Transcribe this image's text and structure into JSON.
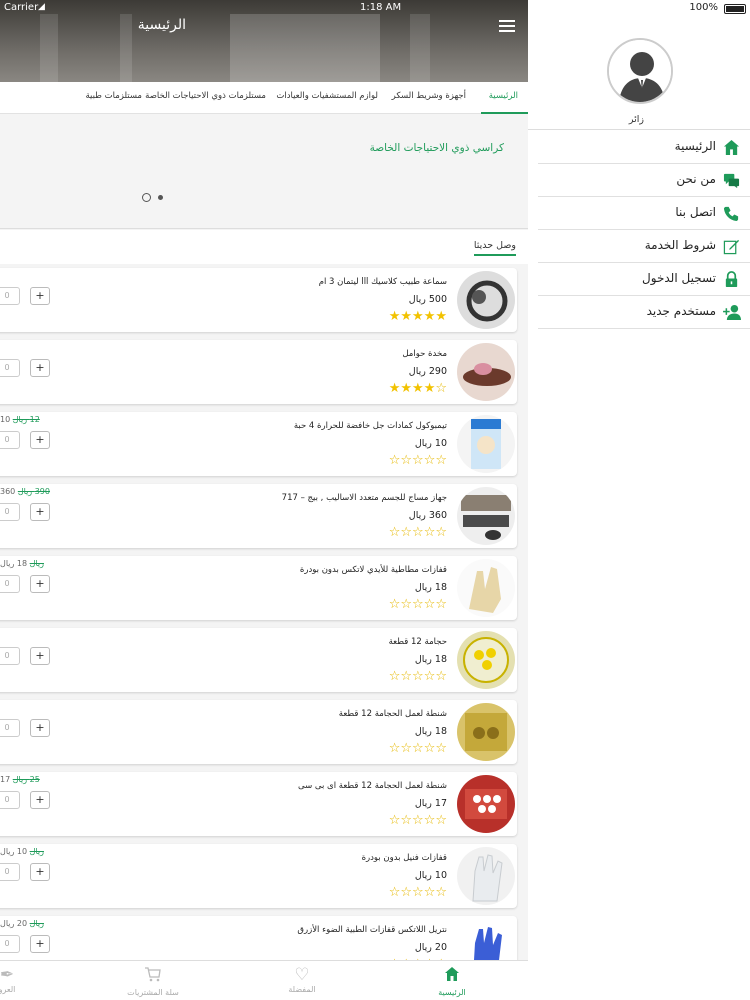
{
  "status_bar": {
    "carrier": "Carrier",
    "time": "1:18 AM",
    "battery": "100%"
  },
  "header": {
    "title": "الرئيسية"
  },
  "category_tabs": [
    {
      "label": "الرئيسية"
    },
    {
      "label": "أجهزة وشريط السكر"
    },
    {
      "label": "لوازم المستشفيات والعيادات"
    },
    {
      "label": "مستلزمات ذوي الاحتياجات الخاصة"
    },
    {
      "label": "مستلزمات طبية"
    }
  ],
  "banner": {
    "text": "كراسي ذوي الاحتياجات الخاصة",
    "page_count": 2,
    "active_page": 1
  },
  "section": {
    "title": "وصل حديثا"
  },
  "products": [
    {
      "name": "سماعة طبيب كلاسيك lll ليتمان 3 ام",
      "price": "500 ريال",
      "rating": 5,
      "quantity": "0",
      "old_price": "",
      "new_price_note": ""
    },
    {
      "name": "مخدة حوامل",
      "price": "290 ريال",
      "rating": 4,
      "quantity": "0",
      "old_price": "",
      "new_price_note": ""
    },
    {
      "name": "تيمبوكول كمادات جل خافضة للحرارة 4 حبة",
      "price": "10 ريال",
      "rating": 0,
      "quantity": "0",
      "old_price": "12 ريال",
      "new_price_note": "10"
    },
    {
      "name": "جهاز مساج للجسم متعدد الاساليب , بيج – 717",
      "price": "360 ريال",
      "rating": 0,
      "quantity": "0",
      "old_price": "390 ريال",
      "new_price_note": "360"
    },
    {
      "name": "قفازات مطاطية للأيدي لاتكس بدون بودرة",
      "price": "18 ريال",
      "rating": 0,
      "quantity": "0",
      "old_price": "ريال",
      "new_price_note": "18 ريال"
    },
    {
      "name": "حجامة 12 قطعة",
      "price": "18 ريال",
      "rating": 0,
      "quantity": "0",
      "old_price": "",
      "new_price_note": ""
    },
    {
      "name": "شنطة لعمل الحجامة 12 قطعة",
      "price": "18 ريال",
      "rating": 0,
      "quantity": "0",
      "old_price": "",
      "new_price_note": ""
    },
    {
      "name": "شنطة لعمل الحجامة 12 قطعة اى بى سى",
      "price": "17 ريال",
      "rating": 0,
      "quantity": "0",
      "old_price": "25 ريال",
      "new_price_note": "17"
    },
    {
      "name": "قفازات فنيل بدون بودرة",
      "price": "10 ريال",
      "rating": 0,
      "quantity": "0",
      "old_price": "ريال",
      "new_price_note": "10 ريال"
    },
    {
      "name": "نتريل اللاتكس قفازات الطبية الضوء الأزرق",
      "price": "20 ريال",
      "rating": 0,
      "quantity": "0",
      "old_price": "ريال",
      "new_price_note": "20 ريال"
    }
  ],
  "bottom_nav": [
    {
      "label": "الرئيسية",
      "icon": "home-icon"
    },
    {
      "label": "المفضلة",
      "icon": "heart-icon"
    },
    {
      "label": "سلة المشتريات",
      "icon": "cart-icon"
    },
    {
      "label": "العرو",
      "icon": "tag-icon"
    }
  ],
  "drawer": {
    "user_name": "زائر",
    "items": [
      {
        "label": "الرئيسية",
        "icon": "home-icon"
      },
      {
        "label": "من نحن",
        "icon": "chat-icon"
      },
      {
        "label": "اتصل بنا",
        "icon": "phone-icon"
      },
      {
        "label": "شروط الخدمة",
        "icon": "edit-icon"
      },
      {
        "label": "تسجيل الدخول",
        "icon": "lock-icon"
      },
      {
        "label": "مستخدم جديد",
        "icon": "add-user-icon"
      }
    ]
  },
  "colors": {
    "accent": "#1f9b5a",
    "star": "#f2c200"
  }
}
